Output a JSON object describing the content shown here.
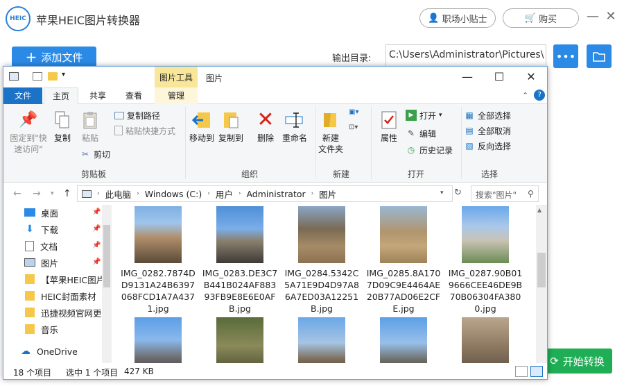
{
  "app": {
    "logo_text": "HEIC",
    "title": "苹果HEIC图片转换器",
    "tips_label": "职场小贴士",
    "buy_label": "购买",
    "add_file_label": "添加文件",
    "output_label": "输出目录:",
    "output_path": "C:\\Users\\Administrator\\Pictures\\",
    "more_label": "•••",
    "start_label": "开始转换"
  },
  "explorer": {
    "context_tab": "图片工具",
    "title": "图片",
    "tabs": [
      "文件",
      "主页",
      "共享",
      "查看",
      "管理"
    ],
    "ribbon": {
      "clipboard": {
        "label": "剪贴板",
        "pin_label": "固定到\"快速访问\"",
        "copy_label": "复制",
        "paste_label": "粘贴",
        "copy_path": "复制路径",
        "paste_shortcut": "粘贴快捷方式",
        "cut": "剪切"
      },
      "organize": {
        "label": "组织",
        "move_to": "移动到",
        "copy_to": "复制到",
        "delete": "删除",
        "rename": "重命名"
      },
      "new": {
        "label": "新建",
        "new_folder": "新建\n文件夹"
      },
      "open": {
        "label": "打开",
        "properties": "属性",
        "open": "打开",
        "edit": "编辑",
        "history": "历史记录"
      },
      "select": {
        "label": "选择",
        "select_all": "全部选择",
        "select_none": "全部取消",
        "invert": "反向选择"
      }
    },
    "address": [
      "此电脑",
      "Windows (C:)",
      "用户",
      "Administrator",
      "图片"
    ],
    "search_placeholder": "搜索\"图片\"",
    "nav": [
      {
        "label": "桌面",
        "icon": "desktop-icon"
      },
      {
        "label": "下载",
        "icon": "download-icon"
      },
      {
        "label": "文档",
        "icon": "document-icon"
      },
      {
        "label": "图片",
        "icon": "pictures-icon"
      },
      {
        "label": "【苹果HEIC图片",
        "icon": "folder-icon"
      },
      {
        "label": "HEIC封面素材",
        "icon": "folder-icon"
      },
      {
        "label": "迅捷视频官网更新",
        "icon": "folder-icon"
      },
      {
        "label": "音乐",
        "icon": "music-icon"
      },
      {
        "label": "OneDrive",
        "icon": "onedrive-icon"
      }
    ],
    "files": [
      {
        "name": "IMG_0282.7874DD9131A24B6397068FCD1A7A4371.jpg"
      },
      {
        "name": "IMG_0283.DE3C7B441B024AF88393FB9E8E6E0AFB.jpg"
      },
      {
        "name": "IMG_0284.5342C5A71E9D4D97A86A7ED03A12251B.jpg"
      },
      {
        "name": "IMG_0285.8A1707D09C9E4464AE20B77AD06E2CFE.jpg"
      },
      {
        "name": "IMG_0287.90B019666CEE46DE9B70B06304FA3800.jpg"
      },
      {
        "name": ""
      },
      {
        "name": ""
      },
      {
        "name": ""
      },
      {
        "name": ""
      },
      {
        "name": ""
      }
    ],
    "status": {
      "count": "18 个项目",
      "selected": "选中 1 个项目",
      "size": "427 KB"
    }
  },
  "colors": {
    "accent_blue": "#2a8ae6",
    "start_green": "#1fae55",
    "file_tab": "#1a73c6",
    "context_tab": "#f8e79a"
  }
}
